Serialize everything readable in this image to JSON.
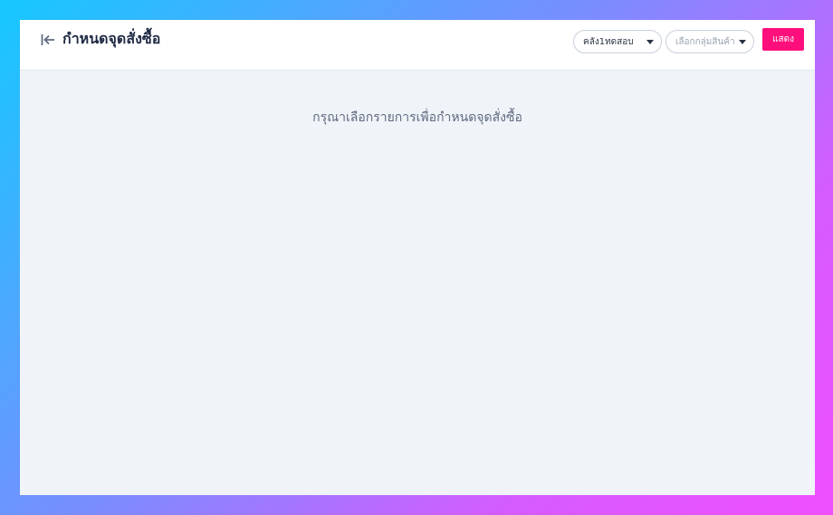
{
  "header": {
    "title": "กำหนดจุดสั่งซื้อ",
    "back_icon": "back-arrow-icon"
  },
  "filters": {
    "warehouse": {
      "value": "คลัง1ทดสอบ"
    },
    "product_group": {
      "placeholder": "เลือกกลุ่มสินค้า"
    },
    "show_button_label": "แสดง"
  },
  "main": {
    "empty_message": "กรุณาเลือกรายการเพื่อกำหนดจุดสั่งซื้อ"
  },
  "colors": {
    "accent": "#ff0f7b",
    "header_bg": "#ffffff",
    "content_bg": "#f0f3f8",
    "title_text": "#1f2a44"
  }
}
